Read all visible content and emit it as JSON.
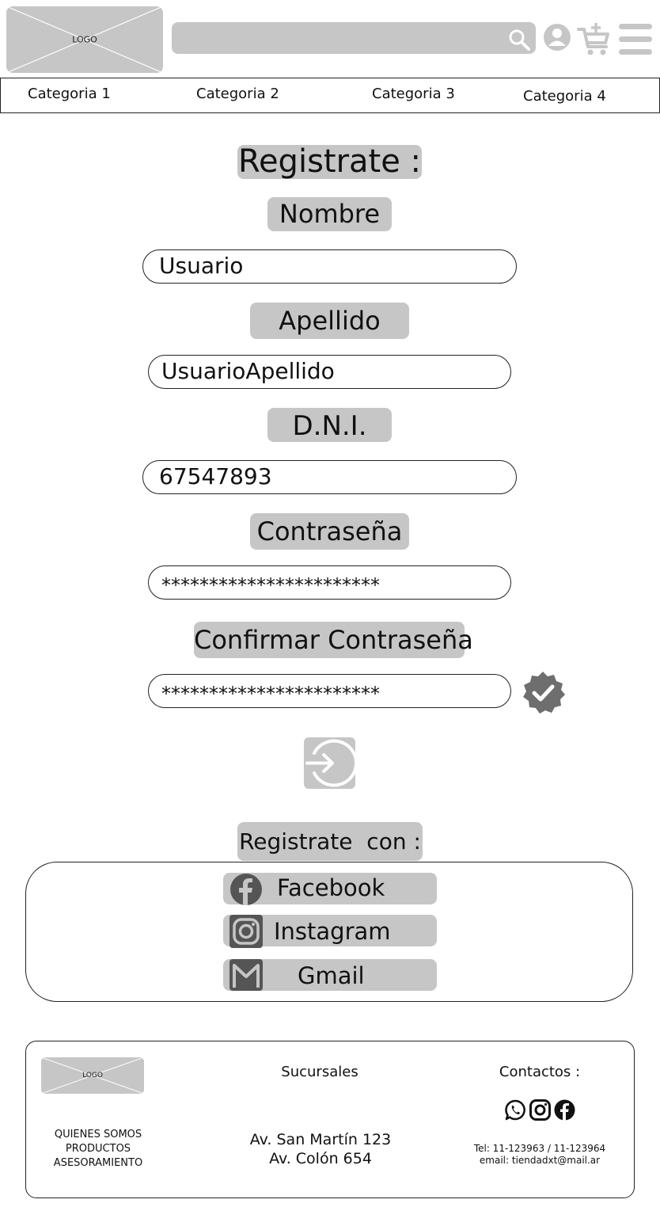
{
  "header": {
    "logo_text": "LOGO",
    "icons": [
      "search-icon",
      "user-icon",
      "cart-add-icon",
      "menu-icon"
    ]
  },
  "categories": [
    "Categoria 1",
    "Categoria 2",
    "Categoria 3",
    "Categoria 4"
  ],
  "form": {
    "title": "Registrate :",
    "nombre_label": "Nombre",
    "nombre_value": "Usuario",
    "apellido_label": "Apellido",
    "apellido_value": "UsuarioApellido",
    "dni_label": "D.N.I.",
    "dni_value": "67547893",
    "password_label": "Contraseña",
    "password_value": "***********************",
    "confirm_label": "Confirmar Contraseña",
    "confirm_value": "***********************",
    "submit_icon": "login-arrow-icon",
    "verified_icon": "verified-badge-icon"
  },
  "social": {
    "title": "Registrate  con :",
    "facebook": "Facebook",
    "instagram": "Instagram",
    "gmail": "Gmail"
  },
  "footer": {
    "logo_text": "LOGO",
    "links": [
      "QUIENES SOMOS",
      "PRODUCTOS",
      "ASESORAMIENTO"
    ],
    "branches_title": "Sucursales",
    "branches": [
      "Av. San Martín 123",
      "Av. Colón 654"
    ],
    "contacts_title": "Contactos :",
    "phone": "Tel: 11-123963 / 11-123964",
    "email": "email: tiendadxt@mail.ar"
  },
  "colors": {
    "gray": "#c6c6c6",
    "icon_gray": "#6e6e6e",
    "dark_icon": "#555555"
  }
}
